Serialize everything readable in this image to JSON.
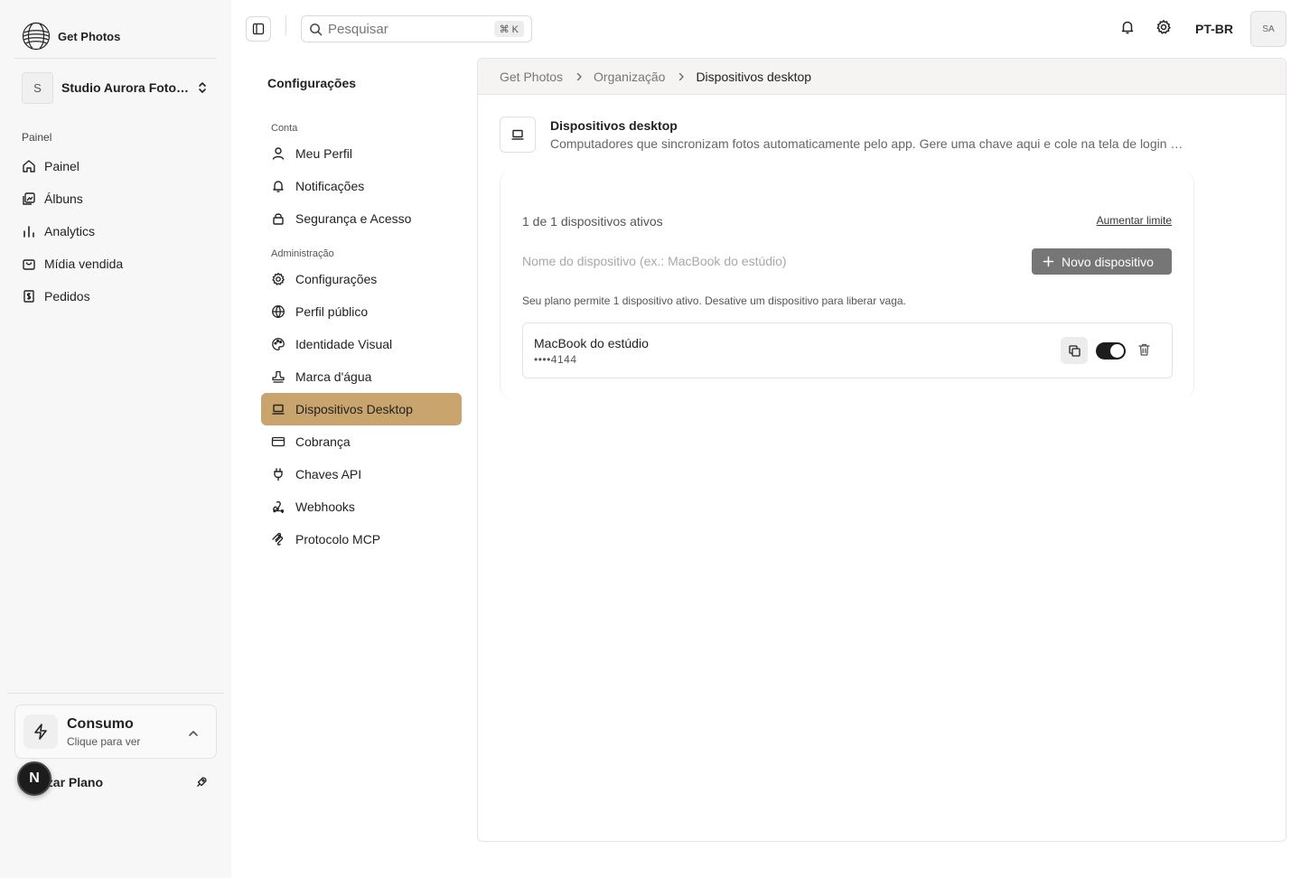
{
  "brand": {
    "name": "Get Photos"
  },
  "org": {
    "avatar_letter": "S",
    "name": "Studio Aurora Fotografia"
  },
  "sidebar": {
    "group_label": "Painel",
    "items": [
      {
        "label": "Painel",
        "icon": "home-icon"
      },
      {
        "label": "Álbuns",
        "icon": "images-icon"
      },
      {
        "label": "Analytics",
        "icon": "bar-chart-icon"
      },
      {
        "label": "Mídia vendida",
        "icon": "shopping-bag-icon"
      },
      {
        "label": "Pedidos",
        "icon": "receipt-icon"
      }
    ],
    "usage": {
      "title": "Consumo",
      "subtitle": "Clique para ver"
    },
    "upgrade_label": "lizar Plano",
    "n_badge": "N"
  },
  "topbar": {
    "search_placeholder": "Pesquisar",
    "search_shortcut": "⌘ K",
    "language": "PT-BR",
    "user_initials": "SA"
  },
  "settings_nav": {
    "title": "Configurações",
    "groups": [
      {
        "label": "Conta",
        "items": [
          {
            "label": "Meu Perfil",
            "icon": "user-icon"
          },
          {
            "label": "Notificações",
            "icon": "bell-icon"
          },
          {
            "label": "Segurança e Acesso",
            "icon": "lock-icon"
          }
        ]
      },
      {
        "label": "Administração",
        "items": [
          {
            "label": "Configurações",
            "icon": "gear-icon"
          },
          {
            "label": "Perfil público",
            "icon": "globe-icon"
          },
          {
            "label": "Identidade Visual",
            "icon": "palette-icon"
          },
          {
            "label": "Marca d'água",
            "icon": "stamp-icon"
          },
          {
            "label": "Dispositivos Desktop",
            "icon": "laptop-icon",
            "active": true
          },
          {
            "label": "Cobrança",
            "icon": "credit-card-icon"
          },
          {
            "label": "Chaves API",
            "icon": "plug-icon"
          },
          {
            "label": "Webhooks",
            "icon": "webhook-icon"
          },
          {
            "label": "Protocolo MCP",
            "icon": "mcp-icon"
          }
        ]
      }
    ]
  },
  "breadcrumb": [
    "Get Photos",
    "Organização",
    "Dispositivos desktop"
  ],
  "section": {
    "title": "Dispositivos desktop",
    "description": "Computadores que sincronizam fotos automaticamente pelo app. Gere uma chave aqui e cole na tela de login do app desktop."
  },
  "devices": {
    "active_count_text": "1 de 1 dispositivos ativos",
    "raise_limit_label": "Aumentar limite",
    "name_placeholder": "Nome do dispositivo (ex.: MacBook do estúdio)",
    "new_device_label": "Novo dispositivo",
    "plan_note": "Seu plano permite 1 dispositivo ativo. Desative um dispositivo para liberar vaga.",
    "list": [
      {
        "name": "MacBook do estúdio",
        "key_masked": "••••4144",
        "enabled": true
      }
    ]
  },
  "colors": {
    "accent": "#c9a46c",
    "toggle_on": "#1c1c1c",
    "button_disabled": "#767676"
  }
}
